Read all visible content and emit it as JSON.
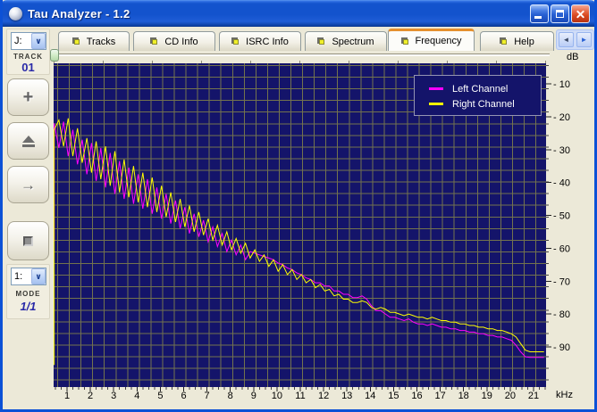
{
  "window": {
    "title": "Tau Analyzer - 1.2",
    "controls": {
      "minimize": "minimize",
      "maximize": "maximize",
      "close": "close"
    }
  },
  "tabs": {
    "items": [
      {
        "label": "Tracks",
        "active": false
      },
      {
        "label": "CD Info",
        "active": false
      },
      {
        "label": "ISRC Info",
        "active": false
      },
      {
        "label": "Spectrum",
        "active": false
      },
      {
        "label": "Frequency",
        "active": true
      },
      {
        "label": "Help",
        "active": false
      }
    ],
    "scroll_left": "◄",
    "scroll_right": "►"
  },
  "sidebar": {
    "drive_combo": {
      "value": "J:",
      "chevron": "∨"
    },
    "track_label": "TRACK",
    "track_value": "01",
    "buttons": {
      "add": "+",
      "eject": "eject",
      "next": "→",
      "stop": "stop"
    },
    "mode_combo": {
      "value": "1:",
      "chevron": "∨"
    },
    "mode_label": "MODE",
    "mode_value": "1/1"
  },
  "legend": {
    "items": [
      "Left Channel",
      "Right Channel"
    ]
  },
  "chart_data": {
    "type": "line",
    "title": "Frequency spectrum",
    "x_unit": "kHz",
    "y_unit": "dB",
    "x_ticks": [
      1,
      2,
      3,
      4,
      5,
      6,
      7,
      8,
      9,
      10,
      11,
      12,
      13,
      14,
      15,
      16,
      17,
      18,
      19,
      20,
      21
    ],
    "y_tick_labels": [
      "- 10",
      "- 20",
      "- 30",
      "- 40",
      "- 50",
      "- 60",
      "- 70",
      "- 80",
      "- 90"
    ],
    "y_tick_values": [
      -10,
      -20,
      -30,
      -40,
      -50,
      -60,
      -70,
      -80,
      -90
    ],
    "x_range_khz": [
      0.43,
      21.5
    ],
    "y_range_db": [
      -3.8,
      -102
    ],
    "grid": true,
    "legend_position": "top-right",
    "plot_bg": "#14146a",
    "grid_color": "#73734d",
    "f_start": 0.45,
    "f_step": 0.2,
    "series": [
      {
        "name": "Left Channel",
        "color": "#ff00ff",
        "edge_dB": -58,
        "dB": [
          -22,
          -29.5,
          -21.5,
          -32,
          -24,
          -34.5,
          -27,
          -37.5,
          -28,
          -39.5,
          -29.5,
          -41.5,
          -31,
          -43.5,
          -33.5,
          -45,
          -35.5,
          -46.5,
          -37.5,
          -48,
          -39,
          -49.5,
          -41.5,
          -51,
          -43.5,
          -52.5,
          -45.5,
          -54,
          -47.5,
          -55.5,
          -49.5,
          -56.5,
          -51.5,
          -58,
          -53.5,
          -59.5,
          -55.5,
          -61,
          -57.5,
          -62,
          -59,
          -63.5,
          -61,
          -61.5,
          -62,
          -62.5,
          -63,
          -63.5,
          -64.5,
          -65,
          -66,
          -66.5,
          -67.5,
          -68,
          -69,
          -69.5,
          -70.5,
          -70.5,
          -71.5,
          -71.5,
          -73,
          -73,
          -74,
          -74,
          -75,
          -75,
          -74.5,
          -75.5,
          -77.5,
          -79,
          -79,
          -80,
          -81,
          -81,
          -81.5,
          -82,
          -81.5,
          -82.5,
          -83,
          -83,
          -83.5,
          -83,
          -83.5,
          -84,
          -84,
          -84.5,
          -84.5,
          -85,
          -85,
          -85.5,
          -85.5,
          -86,
          -86,
          -86.5,
          -86.5,
          -87,
          -87,
          -87.5,
          -88,
          -89.5,
          -91.5,
          -93,
          -93.2,
          -93.2,
          -93.2,
          -93.2
        ]
      },
      {
        "name": "Right Channel",
        "color": "#ffff00",
        "edge_dB": -95.5,
        "dB": [
          -24,
          -21,
          -29,
          -20.5,
          -32,
          -23.5,
          -34,
          -26.5,
          -37,
          -27.5,
          -39,
          -29,
          -41,
          -30.5,
          -43,
          -33,
          -44.5,
          -35,
          -46,
          -37,
          -47.5,
          -38.5,
          -49,
          -41,
          -50.5,
          -43,
          -52,
          -45,
          -53.5,
          -47,
          -55,
          -49,
          -56,
          -51,
          -57.5,
          -53,
          -59,
          -55,
          -60.5,
          -57,
          -61.5,
          -58.5,
          -63,
          -60.5,
          -64,
          -62,
          -65.5,
          -63.5,
          -67,
          -65,
          -68,
          -66.5,
          -69.5,
          -68,
          -70.5,
          -69.5,
          -72,
          -71,
          -73,
          -72.5,
          -74.5,
          -74,
          -75.5,
          -75.5,
          -76.5,
          -76.5,
          -76,
          -76.5,
          -78,
          -78.5,
          -78,
          -78.5,
          -79.5,
          -79.5,
          -80,
          -80.5,
          -80,
          -80.5,
          -81,
          -81,
          -81.5,
          -81,
          -81.5,
          -82,
          -82,
          -82.5,
          -82.5,
          -83,
          -83,
          -83.5,
          -83.5,
          -84,
          -84,
          -84.5,
          -84.5,
          -85,
          -85,
          -85.5,
          -86,
          -87,
          -89,
          -91,
          -91.5,
          -91.5,
          -91.5,
          -91.5
        ]
      }
    ]
  }
}
